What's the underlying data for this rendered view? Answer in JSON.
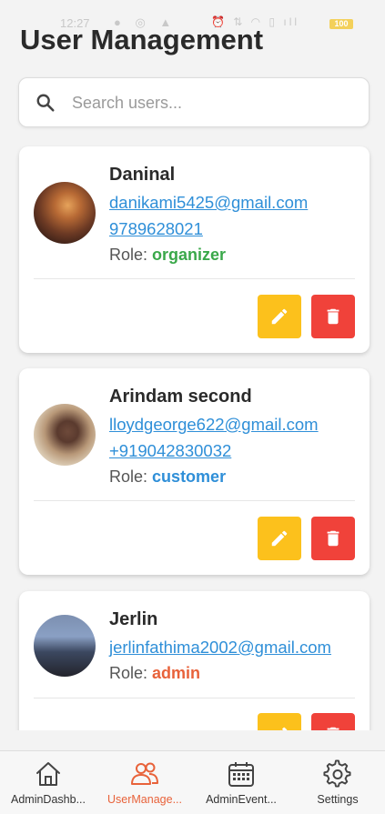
{
  "status_bar": {
    "time": "12:27",
    "battery": "100"
  },
  "page_title": "User Management",
  "search": {
    "placeholder": "Search users...",
    "value": ""
  },
  "users": [
    {
      "name": "Daninal",
      "email": "danikami5425@gmail.com",
      "phone": "9789628021",
      "role_label": "Role:",
      "role": "organizer",
      "role_color": "#3aa84a"
    },
    {
      "name": "Arindam second",
      "email": "lloydgeorge622@gmail.com",
      "phone": "+919042830032",
      "role_label": "Role:",
      "role": "customer",
      "role_color": "#2f8fd8"
    },
    {
      "name": "Jerlin",
      "email": "jerlinfathima2002@gmail.com",
      "phone": "",
      "role_label": "Role:",
      "role": "admin",
      "role_color": "#e8623a"
    }
  ],
  "colors": {
    "accent": "#e8623a",
    "edit": "#fcc11c",
    "delete": "#f0423a",
    "link": "#2f8fd8"
  },
  "bottom_nav": [
    {
      "label": "AdminDashb...",
      "icon": "home-icon",
      "active": false
    },
    {
      "label": "UserManage...",
      "icon": "users-icon",
      "active": true
    },
    {
      "label": "AdminEvent...",
      "icon": "calendar-icon",
      "active": false
    },
    {
      "label": "Settings",
      "icon": "gear-icon",
      "active": false
    }
  ]
}
